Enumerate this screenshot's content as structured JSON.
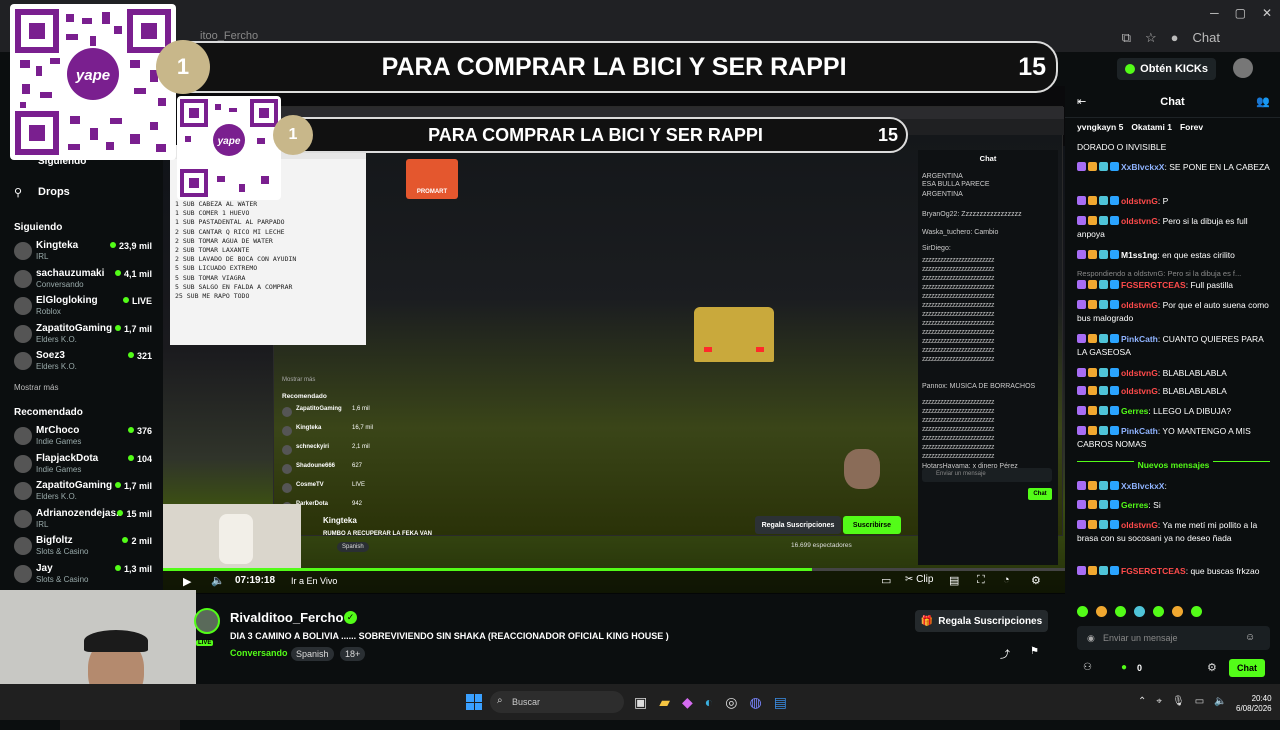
{
  "browser": {
    "tab_text": "itoo_Fercho",
    "chat_tab": "Chat",
    "kicks_label": "Obtén KICKs"
  },
  "banner": {
    "number": "1",
    "title": "PARA COMPRAR LA BICI Y SER RAPPI",
    "count": "15"
  },
  "inner_banner": {
    "number": "1",
    "title": "PARA COMPRAR LA BICI Y SER RAPPI",
    "count": "15"
  },
  "qr": {
    "brand": "yape"
  },
  "sidebar": {
    "top_link": "Siguiendo",
    "drops": "Drops",
    "following_title": "Siguiendo",
    "following": [
      {
        "name": "Kingteka",
        "cat": "IRL",
        "viewers": "23,9 mil"
      },
      {
        "name": "sachauzumaki",
        "cat": "Conversando",
        "viewers": "4,1 mil"
      },
      {
        "name": "ElGlogloking",
        "cat": "Roblox",
        "viewers": "LIVE"
      },
      {
        "name": "ZapatitoGaming",
        "cat": "Elders K.O.",
        "viewers": "1,7 mil"
      },
      {
        "name": "Soez3",
        "cat": "Elders K.O.",
        "viewers": "321"
      }
    ],
    "show_more": "Mostrar más",
    "recommended_title": "Recomendado",
    "recommended": [
      {
        "name": "MrChoco",
        "cat": "Indie Games",
        "viewers": "376"
      },
      {
        "name": "FlapjackDota",
        "cat": "Indie Games",
        "viewers": "104"
      },
      {
        "name": "ZapatitoGaming",
        "cat": "Elders K.O.",
        "viewers": "1,7 mil"
      },
      {
        "name": "Adrianozendejas...",
        "cat": "IRL",
        "viewers": "15 mil"
      },
      {
        "name": "Bigfoltz",
        "cat": "Slots & Casino",
        "viewers": "2 mil"
      },
      {
        "name": "Jay",
        "cat": "Slots & Casino",
        "viewers": "1,3 mil"
      }
    ]
  },
  "notepad": {
    "lines": [
      "1 SUB CABEZA AL WATER",
      "1 SUB COMER 1 HUEVO",
      "1 SUB PASTADENTAL AL PARPADO",
      "2 SUB CANTAR Q RICO MI LECHE",
      "2 SUB TOMAR AGUA DE WATER",
      "2 SUB TOMAR LAXANTE",
      "2 SUB LAVADO DE BOCA CON AYUDIN",
      "5 SUB LICUADO EXTREMO",
      "5 SUB TOMAR VIAGRA",
      "5 SUB SALGO EN FALDA A COMPRAR",
      "25 SUB ME RAPO TODO"
    ]
  },
  "inner": {
    "streamer": "Kingteka",
    "stream_title": "RUMBO A RECUPERAR LA FEKA VAN",
    "tag": "Spanish",
    "gift": "Regala Suscripciones",
    "subscribe": "Suscribirse",
    "viewers": "16.699 espectadores",
    "chat_title": "Chat",
    "chat_input": "Enviar un mensaje",
    "chat_btn": "Chat",
    "shop": "PROMART",
    "sidebar_recommended": "Recomendado",
    "show_more": "Mostrar más",
    "list": [
      {
        "name": "ZapatitoGaming",
        "viewers": "1,6 mil"
      },
      {
        "name": "Kingteka",
        "viewers": "16,7 mil"
      },
      {
        "name": "schneckyiri",
        "viewers": "2,1 mil"
      },
      {
        "name": "Shadoune666",
        "viewers": "627"
      },
      {
        "name": "CosmeTV",
        "viewers": "LIVE"
      },
      {
        "name": "ParkerDota",
        "viewers": "942"
      }
    ],
    "chat_lines": [
      "ARGENTINA",
      "ESA BULLA PARECE",
      "ARGENTINA",
      "BryanOg22: Zzzzzzzzzzzzzzzzz",
      "Waska_tuchero: Cambio",
      "SirDiego:",
      "Pannox: MUSICA DE BORRACHOS",
      "HotarsHayama: x dinero Pérez"
    ]
  },
  "controls": {
    "time": "07:19:18",
    "live": "Ir a En Vivo",
    "clip": "Clip",
    "progress": 0.72
  },
  "info": {
    "name": "Rivalditoo_Fercho",
    "desc": "DIA 3 CAMINO A BOLIVIA ...... SOBREVIVIENDO SIN SHAKA  (REACCIONADOR OFICIAL KING HOUSE )",
    "category": "Conversando",
    "tags": [
      "Spanish",
      "18+"
    ],
    "gift": "Regala Suscripciones",
    "live_badge": "LIVE"
  },
  "chat": {
    "title": "Chat",
    "pinned": [
      "yvngkayn 5",
      "Okatami 1",
      "Forev"
    ],
    "messages": [
      {
        "user": "",
        "text": "DORADO O INVISIBLE",
        "color": ""
      },
      {
        "user": "XxBlvckxX",
        "text": "SE PONE EN LA CABEZA",
        "color": "lbl"
      },
      {
        "user": "oldstvnG",
        "text": "P",
        "color": "red"
      },
      {
        "user": "oldstvnG",
        "text": "Pero si la dibuja es full anpoya",
        "color": "red"
      },
      {
        "user": "M1ss1ng",
        "text": "en que estas cirilito",
        "color": ""
      },
      {
        "user": "Respondiendo a oldstvnG: Pero si la dibuja es f...",
        "text": "",
        "color": "reply"
      },
      {
        "user": "FGSERGTCEAS",
        "text": "Full pastilla",
        "color": "red"
      },
      {
        "user": "oldstvnG",
        "text": "Por que el auto suena como bus malogrado",
        "color": "red"
      },
      {
        "user": "PinkCath",
        "text": "CUANTO QUIERES PARA LA GASEOSA",
        "color": "lbl"
      },
      {
        "user": "oldstvnG",
        "text": "BLABLABLABLA",
        "color": "red"
      },
      {
        "user": "oldstvnG",
        "text": "BLABLABLABLA",
        "color": "red"
      },
      {
        "user": "Gerres",
        "text": "LLEGO LA DIBUJA?",
        "color": "grn"
      },
      {
        "user": "PinkCath",
        "text": "YO MANTENGO A MIS CABROS NOMAS",
        "color": "lbl"
      }
    ],
    "new_messages": "Nuevos mensajes",
    "new": [
      {
        "user": "XxBlvckxX",
        "text": "",
        "color": "lbl"
      },
      {
        "user": "Gerres",
        "text": "Si",
        "color": "grn"
      },
      {
        "user": "oldstvnG",
        "text": "Ya me metí mi pollito a la brasa con su socosani ya no deseo ñada",
        "color": "red"
      },
      {
        "user": "FGSERGTCEAS",
        "text": "que buscas frkzao",
        "color": "red"
      }
    ],
    "input_placeholder": "Enviar un mensaje",
    "kicks_count": "0",
    "send": "Chat"
  },
  "taskbar": {
    "search": "Buscar",
    "time": "20:40",
    "date": "6/08/2026"
  }
}
